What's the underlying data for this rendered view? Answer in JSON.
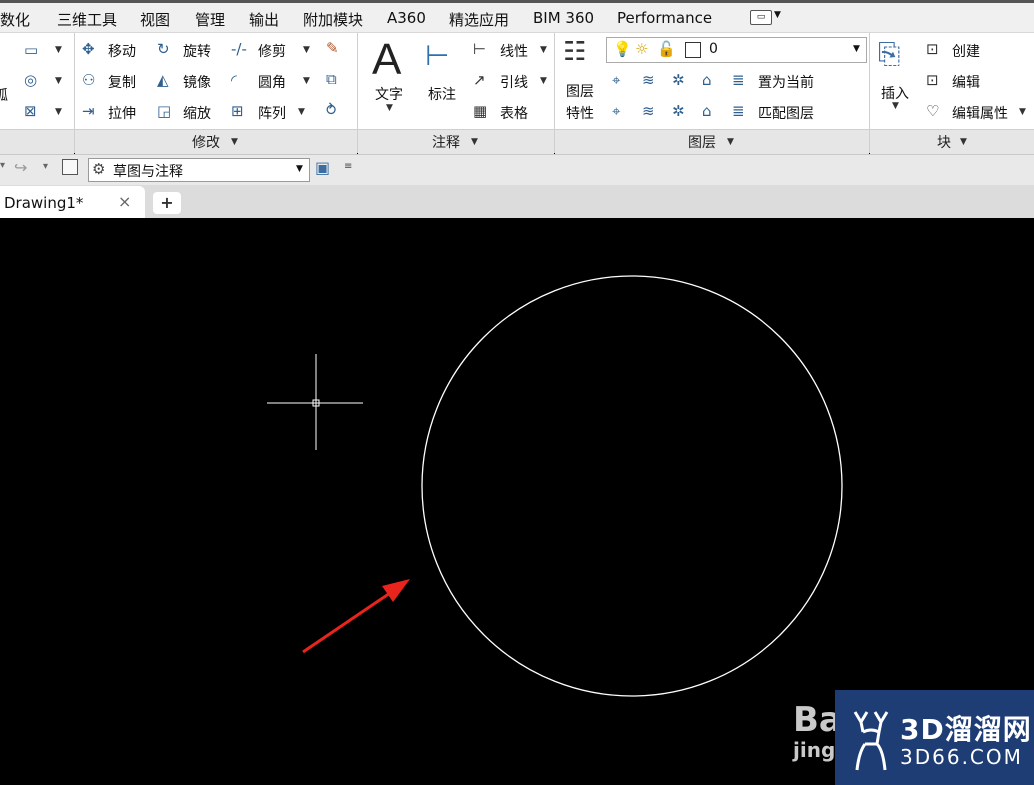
{
  "menu": {
    "items": [
      "数化",
      "三维工具",
      "视图",
      "管理",
      "输出",
      "附加模块",
      "A360",
      "精选应用",
      "BIM 360",
      "Performance"
    ],
    "extra_icon": "minimize-ribbon-icon"
  },
  "ribbon": {
    "modify": {
      "label": "修改",
      "items": {
        "move": "移动",
        "rotate": "旋转",
        "trim": "修剪",
        "copy": "复制",
        "mirror": "镜像",
        "fillet": "圆角",
        "stretch": "拉伸",
        "scale": "缩放",
        "array": "阵列"
      }
    },
    "annotation": {
      "label": "注释",
      "text": "文字",
      "dimension": "标注",
      "linear": "线性",
      "leader": "引线",
      "table": "表格"
    },
    "layers": {
      "label": "图层",
      "layer_props_line1": "图层",
      "layer_props_line2": "特性",
      "current_layer": "0",
      "make_current": "置为当前",
      "match_layer": "匹配图层"
    },
    "block": {
      "label": "块",
      "insert": "插入",
      "create": "创建",
      "edit": "编辑",
      "edit_attributes": "编辑属性"
    },
    "partial_left": "弧"
  },
  "qat": {
    "workspace": "草图与注释"
  },
  "tabs": {
    "doc": "Drawing1*",
    "close": "×",
    "add": "+"
  },
  "watermark": {
    "brand": "3D溜溜网",
    "site": "3D66.COM",
    "left1": "Ba",
    "left2": "jing"
  },
  "colors": {
    "arrow": "#e8241c",
    "canvas": "#000000",
    "circle": "#ffffff"
  }
}
